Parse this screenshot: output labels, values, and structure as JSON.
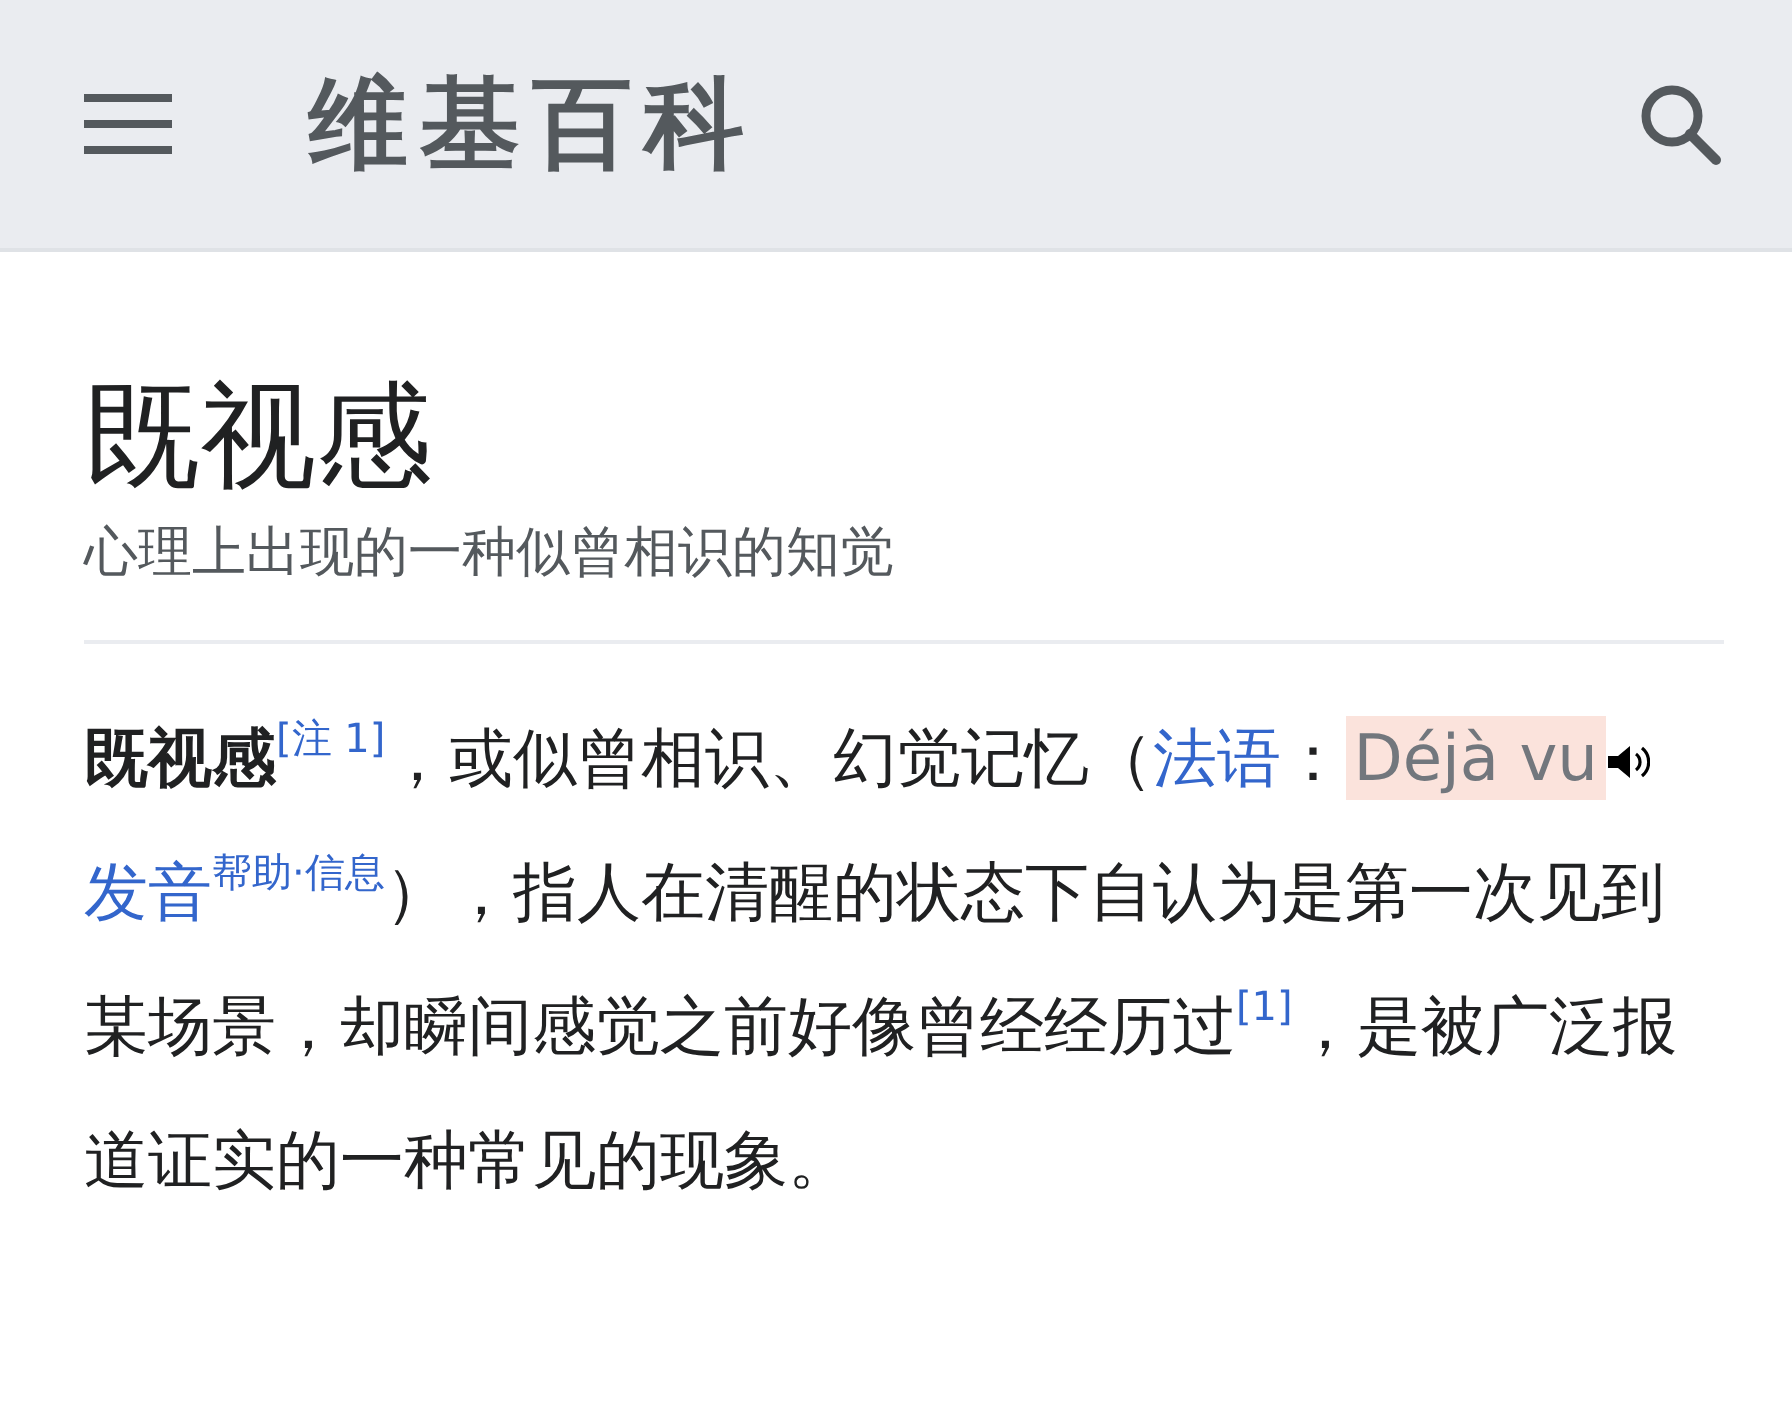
{
  "header": {
    "logo": "维基百科"
  },
  "article": {
    "title": "既视感",
    "subtitle": "心理上出现的一种似曾相识的知觉",
    "segments": [
      {
        "kind": "bold",
        "text": "既视感"
      },
      {
        "kind": "note",
        "text": "[注 1]"
      },
      {
        "kind": "text",
        "text": "，或似曾相识、幻觉记忆（"
      },
      {
        "kind": "link",
        "text": "法语"
      },
      {
        "kind": "text",
        "text": "："
      },
      {
        "kind": "pronunciation",
        "text": "Déjà vu"
      },
      {
        "kind": "link",
        "text": "发音"
      },
      {
        "kind": "sup_link",
        "text": "帮助"
      },
      {
        "kind": "sup_text",
        "text": "·"
      },
      {
        "kind": "sup_link",
        "text": "信息"
      },
      {
        "kind": "text",
        "text": "），指人在清醒的状态下自认为是第一次见到某场景，却瞬间感觉之前好像曾经经历过"
      },
      {
        "kind": "note",
        "text": "[1]"
      },
      {
        "kind": "text",
        "text": "，是被广泛报道证实的一种常见的现象。"
      }
    ]
  }
}
